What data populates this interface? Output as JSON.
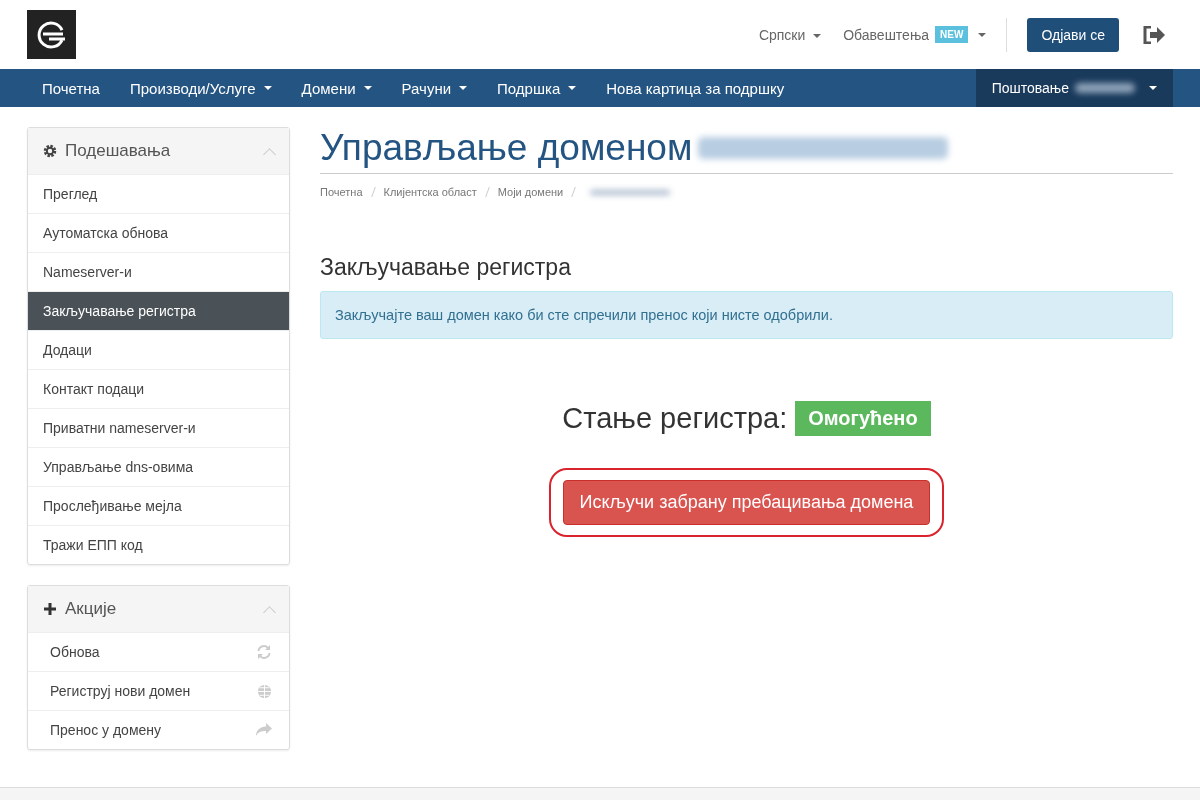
{
  "header": {
    "language": "Српски",
    "notifications": {
      "label": "Обавештења",
      "badge": "NEW"
    },
    "logout": "Одјави се"
  },
  "navbar": {
    "items": [
      {
        "label": "Почетна",
        "dropdown": false
      },
      {
        "label": "Производи/Услуге",
        "dropdown": true
      },
      {
        "label": "Домени",
        "dropdown": true
      },
      {
        "label": "Рачуни",
        "dropdown": true
      },
      {
        "label": "Подршка",
        "dropdown": true
      },
      {
        "label": "Нова картица за подршку",
        "dropdown": false
      }
    ],
    "account": "Поштовање"
  },
  "settings": {
    "title": "Подешавања",
    "items": [
      {
        "label": "Преглед",
        "selected": false
      },
      {
        "label": "Аутоматска обнова",
        "selected": false
      },
      {
        "label": "Nameserver-и",
        "selected": false
      },
      {
        "label": "Закључавање регистра",
        "selected": true
      },
      {
        "label": "Додаци",
        "selected": false
      },
      {
        "label": "Контакт подаци",
        "selected": false
      },
      {
        "label": "Приватни nameserver-и",
        "selected": false
      },
      {
        "label": "Управљање dns-овима",
        "selected": false
      },
      {
        "label": "Прослеђивање мејла",
        "selected": false
      },
      {
        "label": "Тражи ЕПП код",
        "selected": false
      }
    ]
  },
  "actions": {
    "title": "Акције",
    "items": [
      {
        "label": "Обнова",
        "kind": "renew"
      },
      {
        "label": "Региструј нови домен",
        "kind": "register"
      },
      {
        "label": "Пренос у домену",
        "kind": "transfer"
      }
    ]
  },
  "page": {
    "title": "Управљање доменом",
    "breadcrumb": [
      "Почетна",
      "Клијентска област",
      "Моји домени"
    ],
    "section": "Закључавање регистра",
    "info": "Закључајте ваш домен како би сте спречили пренос који нисте одобрили.",
    "status_label": "Стање регистра:",
    "status": {
      "text": "Омогућено",
      "enabled": true
    },
    "button": "Искључи забрану пребацивања домена"
  }
}
